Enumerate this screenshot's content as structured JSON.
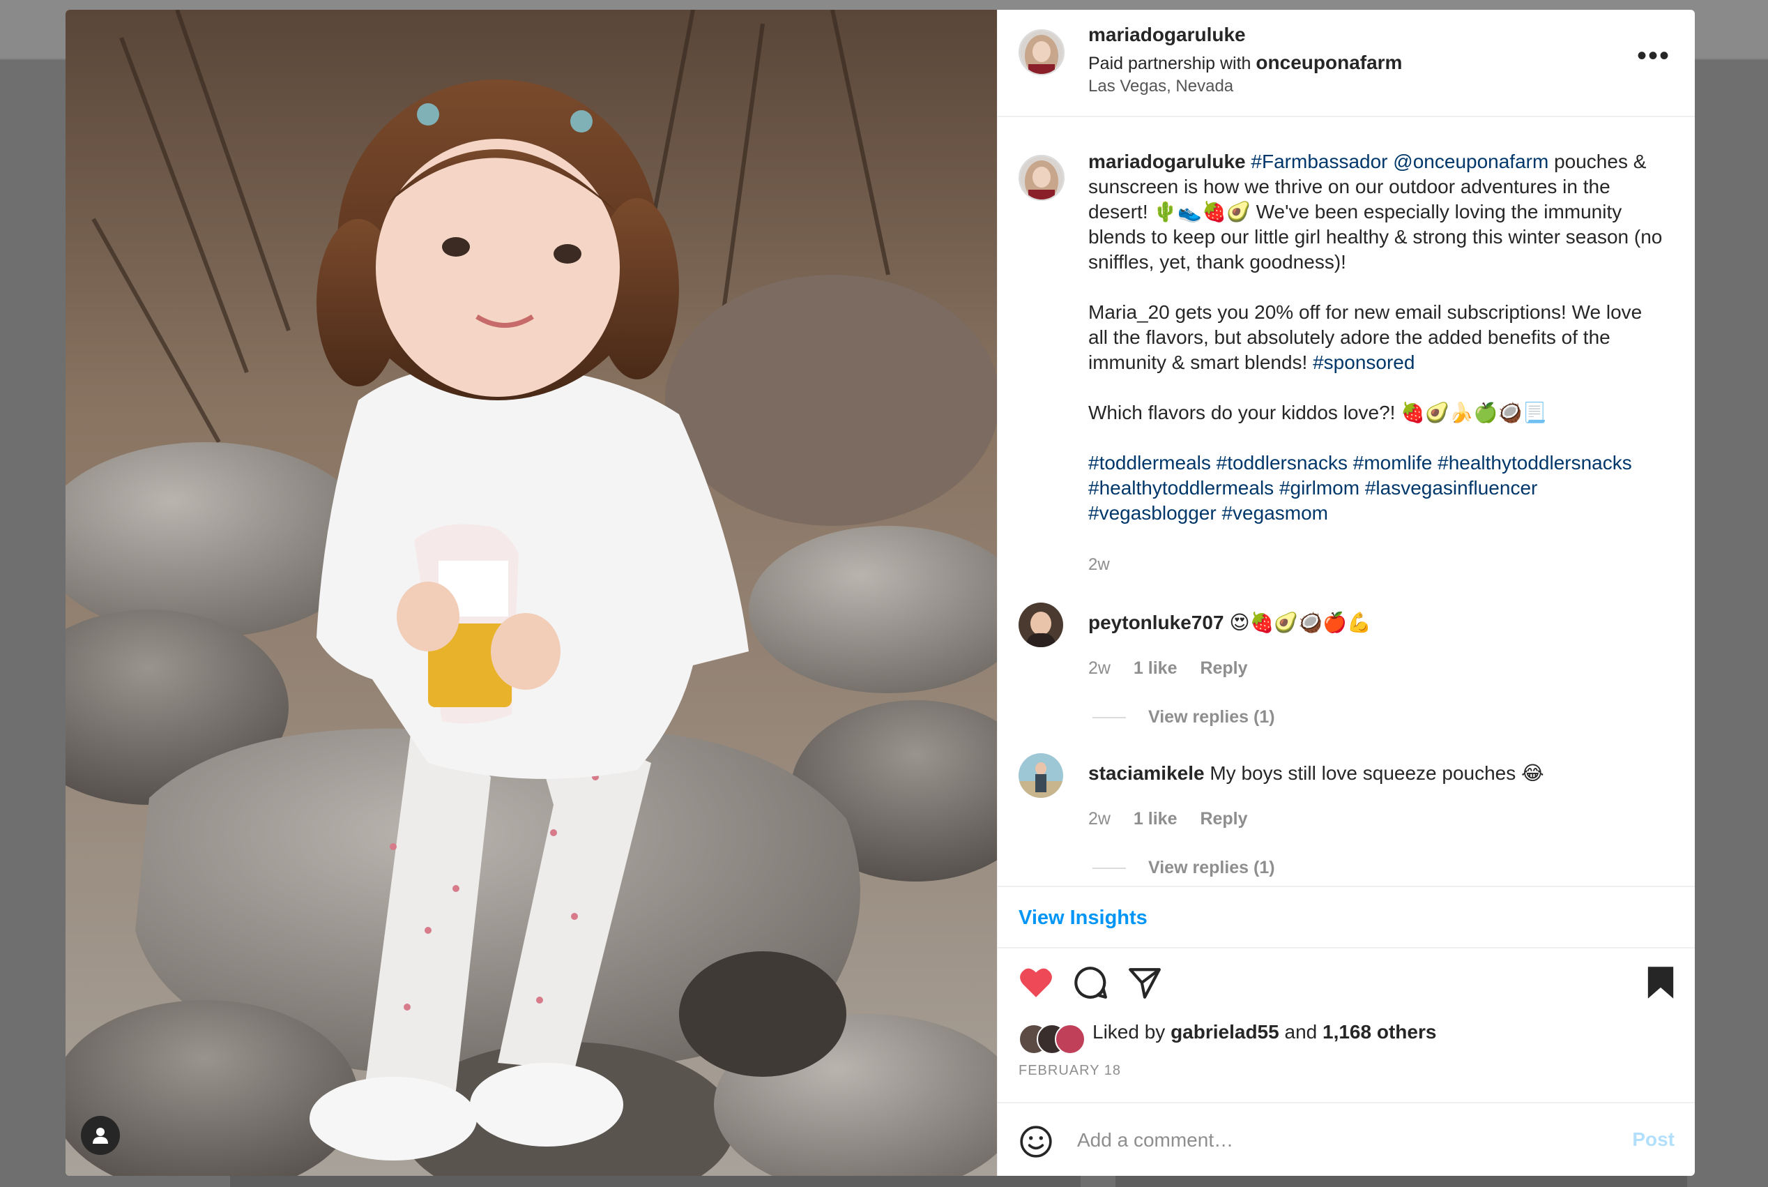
{
  "post": {
    "username": "mariadogaruluke",
    "partnership_prefix": "Paid partnership with",
    "partner": "onceuponafarm",
    "location": "Las Vegas, Nevada",
    "more_label": "•••"
  },
  "caption": {
    "username": "mariadogaruluke",
    "tag1": "#Farmbassador",
    "mention": "@onceuponafarm",
    "text1": " pouches & sunscreen is how we thrive on our outdoor adventures in the desert! 🌵👟🍓🥑 We've been especially loving the immunity blends to keep our little girl healthy & strong this winter season (no sniffles, yet, thank goodness)!",
    "text2": "Maria_20 gets you 20% off for new email subscriptions! We love all the flavors, but absolutely adore the added benefits of the immunity & smart blends! ",
    "tag_sponsored": "#sponsored",
    "text3": "Which flavors do your kiddos love?! 🍓🥑🍌🍏🥥📃",
    "hashtags_line1": "#toddlermeals #toddlersnacks #momlife #healthytoddlersnacks",
    "hashtags_line2": "#healthytoddlermeals #girlmom #lasvegasinfluencer",
    "hashtags_line3": "#vegasblogger #vegasmom",
    "time": "2w"
  },
  "comments": [
    {
      "username": "peytonluke707",
      "text": "😍🍓🥑🥥🍎💪",
      "time": "2w",
      "likes": "1 like",
      "reply": "Reply",
      "view_replies": "View replies (1)"
    },
    {
      "username": "staciamikele",
      "text": "My boys still love squeeze pouches 😂",
      "time": "2w",
      "likes": "1 like",
      "reply": "Reply",
      "view_replies": "View replies (1)"
    }
  ],
  "insights_label": "View Insights",
  "likes": {
    "prefix": "Liked by",
    "user": "gabrielad55",
    "and": "and",
    "others": "1,168 others"
  },
  "date": "FEBRUARY 18",
  "add_comment": {
    "placeholder": "Add a comment…",
    "post_label": "Post"
  },
  "colors": {
    "like_red": "#ed4956",
    "link_blue": "#00376b",
    "accent_blue": "#0095f6",
    "muted": "#8e8e8e"
  },
  "icons": [
    "heart-icon",
    "comment-icon",
    "share-icon",
    "bookmark-icon",
    "emoji-icon",
    "user-tag-icon",
    "more-icon"
  ]
}
